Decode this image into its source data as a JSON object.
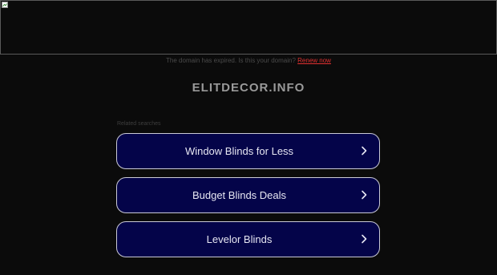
{
  "notice": {
    "text": "The domain has expired. Is this your domain?",
    "renew_link": "Renew now"
  },
  "domain": "ELITDECOR.INFO",
  "related_searches": {
    "label": "Related searches",
    "items": [
      {
        "label": "Window Blinds for Less"
      },
      {
        "label": "Budget Blinds Deals"
      },
      {
        "label": "Levelor Blinds"
      }
    ]
  },
  "colors": {
    "background": "#0b0b0b",
    "button_fill": "#040449",
    "button_border": "#c9c9d6",
    "link": "#e03030"
  },
  "icons": {
    "banner": "broken-image-icon",
    "button_arrow": "chevron-right-icon"
  }
}
